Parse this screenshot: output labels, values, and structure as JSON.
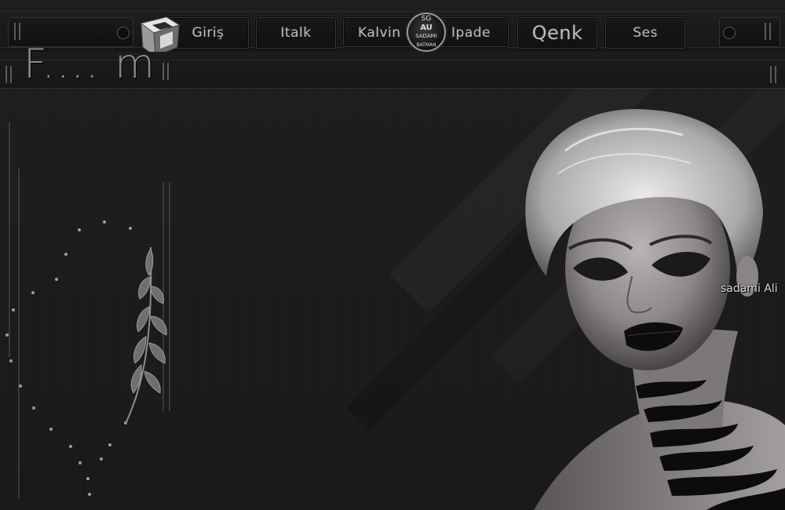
{
  "nav": {
    "items": [
      {
        "id": "giris",
        "label": "Giriş"
      },
      {
        "id": "italk",
        "label": "Italk"
      },
      {
        "id": "kalvin",
        "label": "Kalvin"
      },
      {
        "id": "ipade",
        "label": "Ipade"
      },
      {
        "id": "qenk",
        "label": "Qenk"
      },
      {
        "id": "ses",
        "label": "Ses"
      }
    ]
  },
  "badge": {
    "line1": "SG",
    "line2": "AU",
    "line3": "SADAMI",
    "line4": "BATMAN"
  },
  "logo": {
    "text": "F.... m"
  },
  "signature": {
    "text": "sadami Ali"
  },
  "colors": {
    "background": "#1b1b1b",
    "button_border": "#3a3a3a",
    "text": "#bfbfbf",
    "accent_silver": "#9a9a9a"
  },
  "icons": {
    "cube": "cube-logo-icon",
    "badge": "round-badge-logo",
    "leaf": "leaf-branch-icon"
  }
}
